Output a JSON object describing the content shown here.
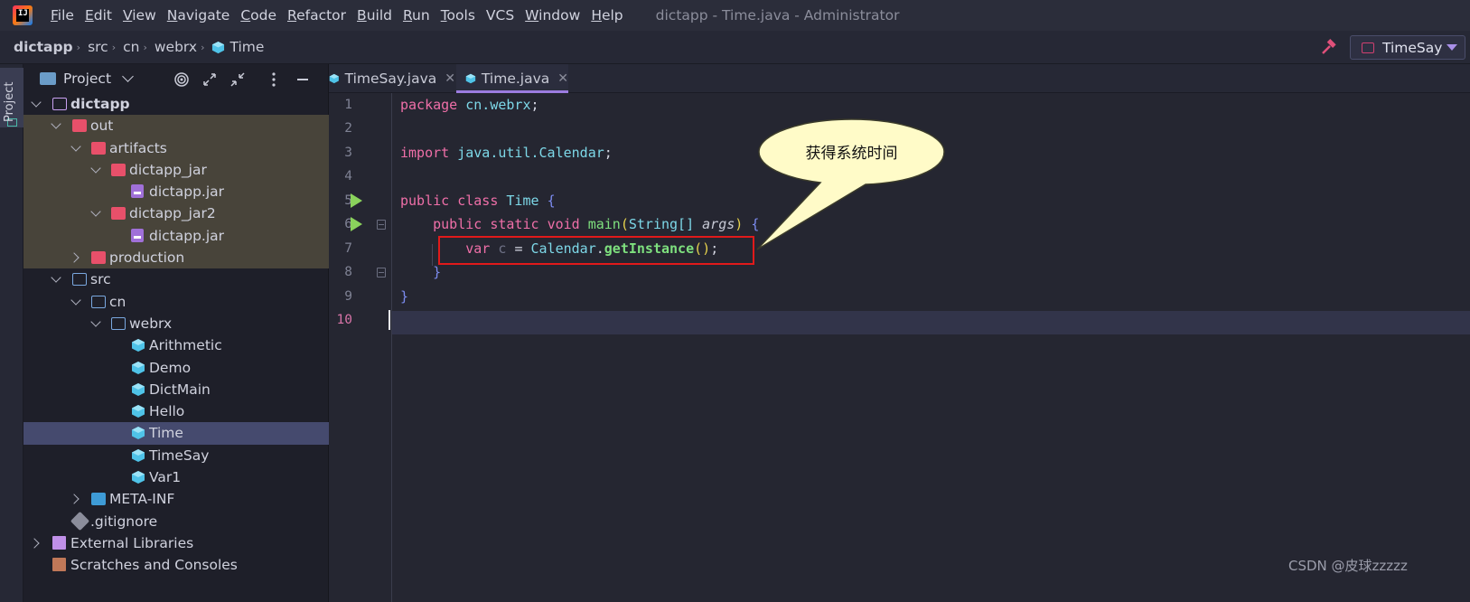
{
  "menubar": {
    "items": [
      {
        "mnemonic": "F",
        "rest": "ile"
      },
      {
        "mnemonic": "E",
        "rest": "dit"
      },
      {
        "mnemonic": "V",
        "rest": "iew"
      },
      {
        "mnemonic": "N",
        "rest": "avigate"
      },
      {
        "mnemonic": "C",
        "rest": "ode"
      },
      {
        "mnemonic": "R",
        "rest": "efactor"
      },
      {
        "mnemonic": "B",
        "rest": "uild"
      },
      {
        "mnemonic": "R",
        "rest": "un"
      },
      {
        "mnemonic": "T",
        "rest": "ools"
      },
      {
        "mnemonic": "",
        "rest": "VCS"
      },
      {
        "mnemonic": "W",
        "rest": "indow"
      },
      {
        "mnemonic": "H",
        "rest": "elp"
      }
    ],
    "window_title": "dictapp - Time.java - Administrator"
  },
  "navbar": {
    "crumbs": [
      "dictapp",
      "src",
      "cn",
      "webrx",
      "Time"
    ],
    "run_config": "TimeSay"
  },
  "tool_strip": {
    "project_label": "Project"
  },
  "project_panel": {
    "title": "Project",
    "tree": [
      {
        "label": "dictapp",
        "bold": true
      },
      {
        "label": "out"
      },
      {
        "label": "artifacts"
      },
      {
        "label": "dictapp_jar"
      },
      {
        "label": "dictapp.jar"
      },
      {
        "label": "dictapp_jar2"
      },
      {
        "label": "dictapp.jar"
      },
      {
        "label": "production"
      },
      {
        "label": "src"
      },
      {
        "label": "cn"
      },
      {
        "label": "webrx"
      },
      {
        "label": "Arithmetic"
      },
      {
        "label": "Demo"
      },
      {
        "label": "DictMain"
      },
      {
        "label": "Hello"
      },
      {
        "label": "Time"
      },
      {
        "label": "TimeSay"
      },
      {
        "label": "Var1"
      },
      {
        "label": "META-INF"
      },
      {
        "label": ".gitignore"
      },
      {
        "label": "External Libraries"
      },
      {
        "label": "Scratches and Consoles"
      }
    ]
  },
  "editor": {
    "tabs": [
      {
        "label": "TimeSay.java",
        "active": false
      },
      {
        "label": "Time.java",
        "active": true
      }
    ],
    "line_numbers": [
      "1",
      "2",
      "3",
      "4",
      "5",
      "6",
      "7",
      "8",
      "9",
      "10"
    ],
    "current_line": "10",
    "code": {
      "l1": {
        "kw": "package",
        "pkg": "cn.webrx",
        "end": ";"
      },
      "l3": {
        "kw": "import",
        "pkg": "java.util.Calendar",
        "end": ";"
      },
      "l5": {
        "kw1": "public",
        "kw2": "class",
        "cls": "Time",
        "brace": "{"
      },
      "l6": {
        "kw1": "public",
        "kw2": "static",
        "kw3": "void",
        "fn": "main",
        "popen": "(",
        "type": "String[]",
        "param": "args",
        "pclose": ")",
        "brace": "{"
      },
      "l7": {
        "kw": "var",
        "var": "c",
        "eq": "=",
        "cls": "Calendar",
        "dot": ".",
        "fn": "getInstance",
        "parens": "()",
        "end": ";"
      },
      "l8": {
        "brace": "}"
      },
      "l9": {
        "brace": "}"
      }
    }
  },
  "annotation": {
    "callout_text": "获得系统时间",
    "highlight_color": "#e01a1a"
  },
  "watermark": "CSDN @皮球zzzzz"
}
